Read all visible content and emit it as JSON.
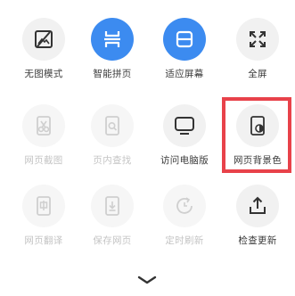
{
  "menu": {
    "items": [
      {
        "label": "无图模式",
        "icon": "image-off-icon",
        "state": "enabled"
      },
      {
        "label": "智能拼页",
        "icon": "page-stitch-icon",
        "state": "active"
      },
      {
        "label": "适应屏幕",
        "icon": "fit-screen-icon",
        "state": "active"
      },
      {
        "label": "全屏",
        "icon": "fullscreen-icon",
        "state": "enabled"
      },
      {
        "label": "网页截图",
        "icon": "scissors-icon",
        "state": "disabled"
      },
      {
        "label": "页内查找",
        "icon": "find-in-page-icon",
        "state": "disabled"
      },
      {
        "label": "访问电脑版",
        "icon": "desktop-icon",
        "state": "enabled"
      },
      {
        "label": "网页背景色",
        "icon": "page-color-icon",
        "state": "enabled",
        "highlighted": true
      },
      {
        "label": "网页翻译",
        "icon": "translate-icon",
        "state": "disabled"
      },
      {
        "label": "保存网页",
        "icon": "save-page-icon",
        "state": "disabled"
      },
      {
        "label": "定时刷新",
        "icon": "timer-refresh-icon",
        "state": "disabled"
      },
      {
        "label": "检查更新",
        "icon": "upload-icon",
        "state": "enabled"
      }
    ]
  },
  "collapse": {
    "icon": "chevron-down-icon"
  },
  "colors": {
    "active_blue": "#3c8bf0",
    "highlight_red": "#e8424a"
  }
}
